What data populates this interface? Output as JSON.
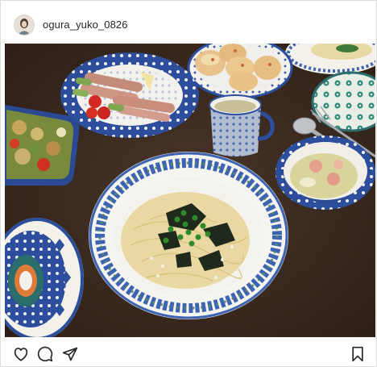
{
  "post": {
    "username": "ogura_yuko_0826"
  },
  "icons": {
    "like": "heart-icon",
    "comment": "comment-icon",
    "share": "share-icon",
    "save": "bookmark-icon"
  },
  "colors": {
    "text": "#262626",
    "border": "#dbdbdb",
    "table": "#3b2a20",
    "pottery_blue": "#2b4f9c"
  }
}
